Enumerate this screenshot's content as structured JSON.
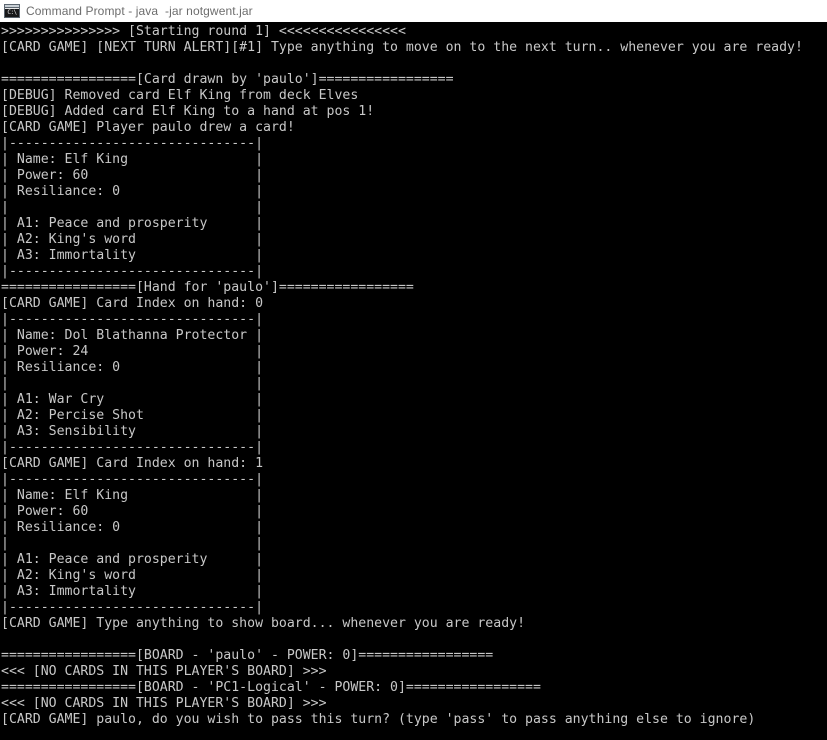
{
  "window": {
    "title": "Command Prompt - java  -jar notgwent.jar",
    "icon_name": "command-prompt-icon",
    "icon_glyph": "C:\\",
    "titlebar_bg": "#ffffff",
    "titlebar_text_color": "#6d6d6d",
    "console_bg": "#000000",
    "console_text_color": "#c8c8c8"
  },
  "console": {
    "lines": [
      ">>>>>>>>>>>>>>> [Starting round 1] <<<<<<<<<<<<<<<<",
      "[CARD GAME] [NEXT TURN ALERT][#1] Type anything to move on to the next turn.. whenever you are ready!",
      "",
      "=================[Card drawn by 'paulo']=================",
      "[DEBUG] Removed card Elf King from deck Elves",
      "[DEBUG] Added card Elf King to a hand at pos 1!",
      "[CARD GAME] Player paulo drew a card!",
      "|-------------------------------|",
      "| Name: Elf King                |",
      "| Power: 60                     |",
      "| Resiliance: 0                 |",
      "|                               |",
      "| A1: Peace and prosperity      |",
      "| A2: King's word               |",
      "| A3: Immortality               |",
      "|-------------------------------|",
      "=================[Hand for 'paulo']=================",
      "[CARD GAME] Card Index on hand: 0",
      "|-------------------------------|",
      "| Name: Dol Blathanna Protector |",
      "| Power: 24                     |",
      "| Resiliance: 0                 |",
      "|                               |",
      "| A1: War Cry                   |",
      "| A2: Percise Shot              |",
      "| A3: Sensibility               |",
      "|-------------------------------|",
      "[CARD GAME] Card Index on hand: 1",
      "|-------------------------------|",
      "| Name: Elf King                |",
      "| Power: 60                     |",
      "| Resiliance: 0                 |",
      "|                               |",
      "| A1: Peace and prosperity      |",
      "| A2: King's word               |",
      "| A3: Immortality               |",
      "|-------------------------------|",
      "[CARD GAME] Type anything to show board... whenever you are ready!",
      "",
      "=================[BOARD - 'paulo' - POWER: 0]=================",
      "<<< [NO CARDS IN THIS PLAYER'S BOARD] >>>",
      "=================[BOARD - 'PC1-Logical' - POWER: 0]=================",
      "<<< [NO CARDS IN THIS PLAYER'S BOARD] >>>",
      "[CARD GAME] paulo, do you wish to pass this turn? (type 'pass' to pass anything else to ignore)"
    ]
  },
  "game": {
    "round": 1,
    "turn_alert_number": "#1",
    "player_name": "paulo",
    "opponent_name": "PC1-Logical",
    "deck_name": "Elves",
    "player_board_power": 0,
    "opponent_board_power": 0,
    "drawn_card": {
      "name": "Elf King",
      "power": 60,
      "resiliance": 0,
      "abilities": [
        "Peace and prosperity",
        "King's word",
        "Immortality"
      ],
      "hand_position": 1
    },
    "hand": [
      {
        "index": 0,
        "name": "Dol Blathanna Protector",
        "power": 24,
        "resiliance": 0,
        "abilities": [
          "War Cry",
          "Percise Shot",
          "Sensibility"
        ]
      },
      {
        "index": 1,
        "name": "Elf King",
        "power": 60,
        "resiliance": 0,
        "abilities": [
          "Peace and prosperity",
          "King's word",
          "Immortality"
        ]
      }
    ],
    "board_empty_message": "<<< [NO CARDS IN THIS PLAYER'S BOARD] >>>",
    "prompt": "[CARD GAME] paulo, do you wish to pass this turn? (type 'pass' to pass anything else to ignore)"
  }
}
